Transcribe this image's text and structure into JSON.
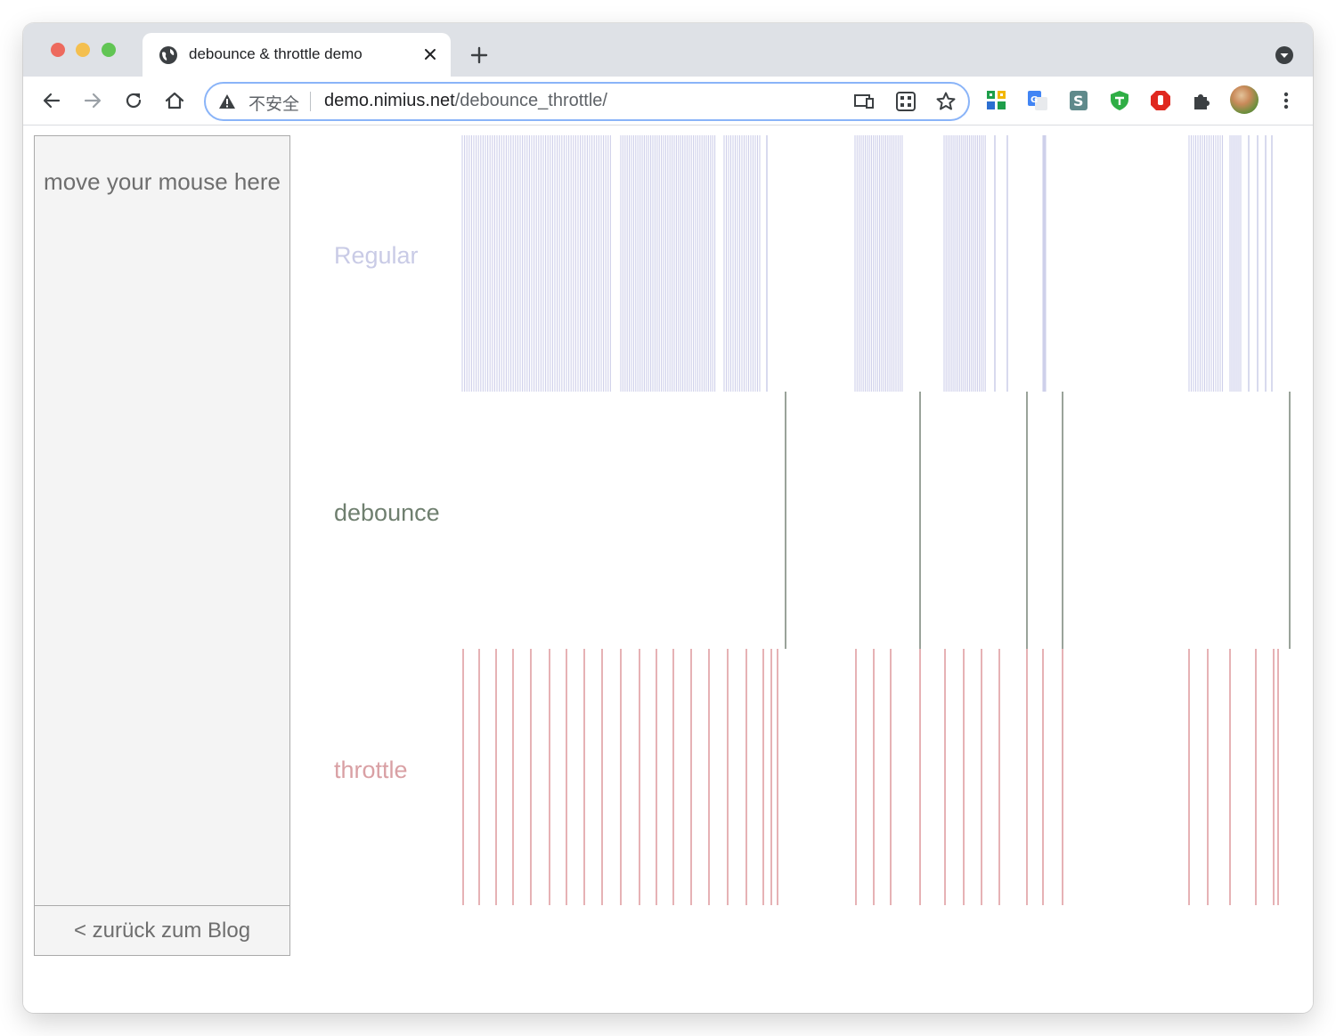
{
  "browser": {
    "tab_title": "debounce & throttle demo",
    "address": {
      "security_label": "不安全",
      "host": "demo.nimius.net",
      "path": "/debounce_throttle/"
    }
  },
  "page": {
    "mouse_area_text": "move your mouse here",
    "back_link": "< zurück zum Blog",
    "rows": [
      {
        "label": "Regular",
        "color": "#c9cbe6"
      },
      {
        "label": "debounce",
        "color": "#6f7f6f"
      },
      {
        "label": "throttle",
        "color": "#d9a0a4"
      }
    ]
  },
  "chart_data": {
    "type": "event-strips",
    "regular_color": "#cfd0ea",
    "debounce_color": "#9aa39a",
    "throttle_color": "#e3a9ad",
    "regular_clusters": [
      [
        519,
        688,
        2.6
      ],
      [
        697,
        804,
        2.4
      ],
      [
        813,
        855,
        2.5
      ],
      [
        861,
        862,
        1
      ],
      [
        960,
        1013,
        2.3
      ],
      [
        1060,
        1108,
        2.2
      ],
      [
        1117,
        1118,
        1
      ],
      [
        1131,
        1133,
        1
      ],
      [
        1171,
        1174,
        1
      ],
      [
        1335,
        1374,
        2.5
      ],
      [
        1381,
        1394,
        2.0
      ],
      [
        1402,
        1403,
        1
      ],
      [
        1412,
        1413,
        1
      ],
      [
        1421,
        1422,
        1
      ],
      [
        1428,
        1429,
        1
      ]
    ],
    "debounce_events": [
      882,
      1033,
      1153,
      1193,
      1448
    ],
    "throttle_events": [
      520,
      538,
      557,
      576,
      596,
      617,
      636,
      656,
      676,
      697,
      718,
      737,
      756,
      776,
      796,
      817,
      838,
      857,
      866,
      873,
      961,
      981,
      1000,
      1033,
      1061,
      1082,
      1102,
      1122,
      1153,
      1171,
      1193,
      1335,
      1356,
      1381,
      1410,
      1430,
      1435
    ]
  }
}
